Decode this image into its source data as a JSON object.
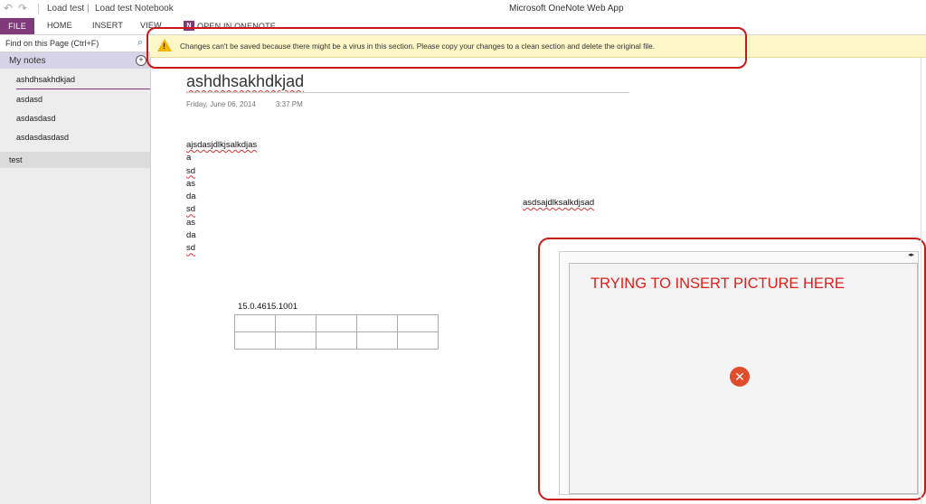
{
  "titlebar": {
    "breadcrumb": [
      "Load test",
      "Load test Notebook"
    ],
    "breadcrumb_separator": "|",
    "app_title": "Microsoft OneNote Web App"
  },
  "ribbon": {
    "tabs": [
      "FILE",
      "HOME",
      "INSERT",
      "VIEW"
    ],
    "open_in_onenote": "OPEN IN ONENOTE",
    "logo_letter": "N",
    "file_tab_color": "#80397b"
  },
  "sidebar": {
    "search_placeholder": "Find on this Page (Ctrl+F)",
    "notebook": "My notes",
    "pages": [
      "ashdhsakhdkjad",
      "asdasd",
      "asdasdasd",
      "asdasdasdasd"
    ],
    "active_page": "ashdhsakhdkjad",
    "section": "test"
  },
  "warning": {
    "message": "Changes can't be saved because there might be a virus in this section. Please copy your changes to a clean section and delete the original file.",
    "icon": "warning-triangle-icon"
  },
  "page": {
    "title": "ashdhsakhdkjad",
    "date": "Friday, June 06, 2014",
    "time": "3:37 PM",
    "lines": [
      "ajsdasjdlkjsalkdjas",
      "a",
      "sd",
      "as",
      "da",
      "sd",
      "as",
      "da",
      "sd"
    ],
    "floating_text": "asdsajdlksalkdjsad",
    "version_text": "15.0.4615.1001",
    "table": {
      "rows": 2,
      "cols": 5
    }
  },
  "picture": {
    "caption": "TRYING TO INSERT PICTURE HERE",
    "error_icon": "error-x-icon",
    "caption_color": "#e0201b"
  }
}
